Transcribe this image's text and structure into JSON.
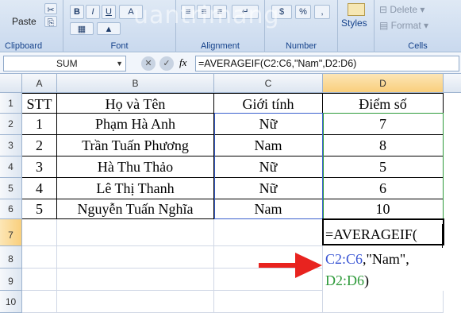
{
  "ribbon": {
    "paste_label": "Paste",
    "clipboard_label": "Clipboard",
    "font_label": "Font",
    "alignment_label": "Alignment",
    "number_label": "Number",
    "styles_label": "Styles",
    "cells_label": "Cells",
    "delete_label": "Delete",
    "format_label": "Format",
    "currency_symbol": "$",
    "percent_symbol": "%",
    "watermark": "uantrimang"
  },
  "formula_bar": {
    "name_box": "SUM",
    "fx_label": "fx",
    "formula": "=AVERAGEIF(C2:C6,\"Nam\",D2:D6)"
  },
  "columns": [
    "A",
    "B",
    "C",
    "D"
  ],
  "rows": [
    "1",
    "2",
    "3",
    "4",
    "5",
    "6",
    "7",
    "8",
    "9",
    "10"
  ],
  "table": {
    "header": [
      "STT",
      "Họ và Tên",
      "Giới tính",
      "Điểm số"
    ],
    "rows": [
      [
        "1",
        "Phạm Hà Anh",
        "Nữ",
        "7"
      ],
      [
        "2",
        "Trần Tuấn Phương",
        "Nam",
        "8"
      ],
      [
        "3",
        "Hà Thu Thảo",
        "Nữ",
        "5"
      ],
      [
        "4",
        "Lê Thị Thanh",
        "Nữ",
        "6"
      ],
      [
        "5",
        "Nguyễn Tuấn Nghĩa",
        "Nam",
        "10"
      ]
    ]
  },
  "editing_cell": {
    "line1": "=AVERAGEIF(",
    "line2_ref": "C2:C6",
    "line2_rest": ",\"Nam\",",
    "line3_ref": "D2:D6",
    "line3_rest": ")"
  },
  "colors": {
    "ref_c": "#3a56d4",
    "ref_d": "#2e9a3a",
    "arrow": "#e8231f"
  }
}
